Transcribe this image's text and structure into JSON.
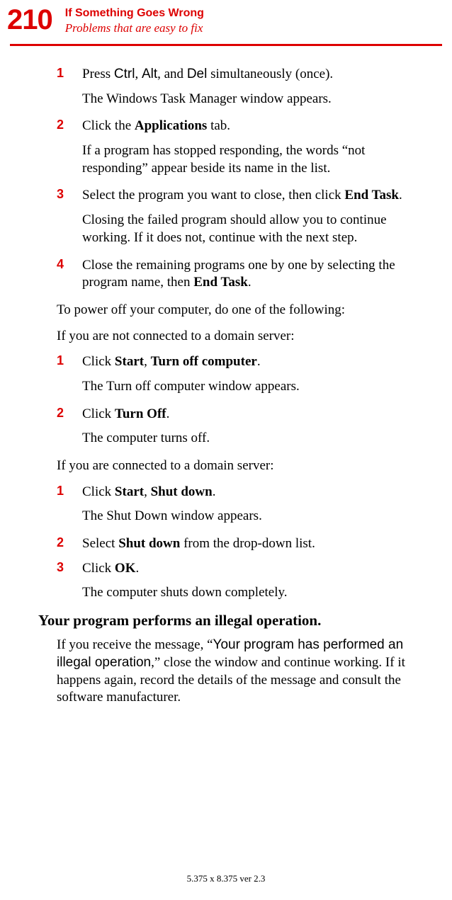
{
  "header": {
    "page_number": "210",
    "chapter_title": "If Something Goes Wrong",
    "section_title": "Problems that are easy to fix"
  },
  "block1": {
    "s1_num": "1",
    "s1_a": "Press ",
    "s1_ctrl": "Ctrl",
    "s1_b": ", ",
    "s1_alt": "Alt",
    "s1_c": ", and ",
    "s1_del": "Del",
    "s1_d": " simultaneously (once).",
    "s1_sub": "The Windows Task Manager window appears.",
    "s2_num": "2",
    "s2_a": "Click the ",
    "s2_b": "Applications",
    "s2_c": " tab.",
    "s2_sub": "If a program has stopped responding, the words “not responding” appear beside its name in the list.",
    "s3_num": "3",
    "s3_a": "Select the program you want to close, then click ",
    "s3_b": "End Task",
    "s3_c": ".",
    "s3_sub": "Closing the failed program should allow you to continue working. If it does not, continue with the next step.",
    "s4_num": "4",
    "s4_a": "Close the remaining programs one by one by selecting the program name, then ",
    "s4_b": "End Task",
    "s4_c": "."
  },
  "para1": "To power off your computer, do one of the following:",
  "para2": "If you are not connected to a domain server:",
  "block2": {
    "s1_num": "1",
    "s1_a": "Click ",
    "s1_b": "Start",
    "s1_c": ", ",
    "s1_d": "Turn off computer",
    "s1_e": ".",
    "s1_sub": "The Turn off computer window appears.",
    "s2_num": "2",
    "s2_a": "Click ",
    "s2_b": "Turn Off",
    "s2_c": ".",
    "s2_sub": "The computer turns off."
  },
  "para3": "If you are connected to a domain server:",
  "block3": {
    "s1_num": "1",
    "s1_a": "Click ",
    "s1_b": "Start",
    "s1_c": ", ",
    "s1_d": "Shut down",
    "s1_e": ".",
    "s1_sub": "The Shut Down window appears.",
    "s2_num": "2",
    "s2_a": "Select ",
    "s2_b": "Shut down",
    "s2_c": " from the drop-down list.",
    "s3_num": "3",
    "s3_a": "Click ",
    "s3_b": "OK",
    "s3_c": ".",
    "s3_sub": "The computer shuts down completely."
  },
  "heading": "Your program performs an illegal operation.",
  "illegal": {
    "a": "If you receive the message, “",
    "b": "Your program has performed an illegal operation",
    "c": ",” close the window and continue working. If it happens again, record the details of the message and consult the software manufacturer."
  },
  "footer": "5.375 x 8.375 ver 2.3"
}
